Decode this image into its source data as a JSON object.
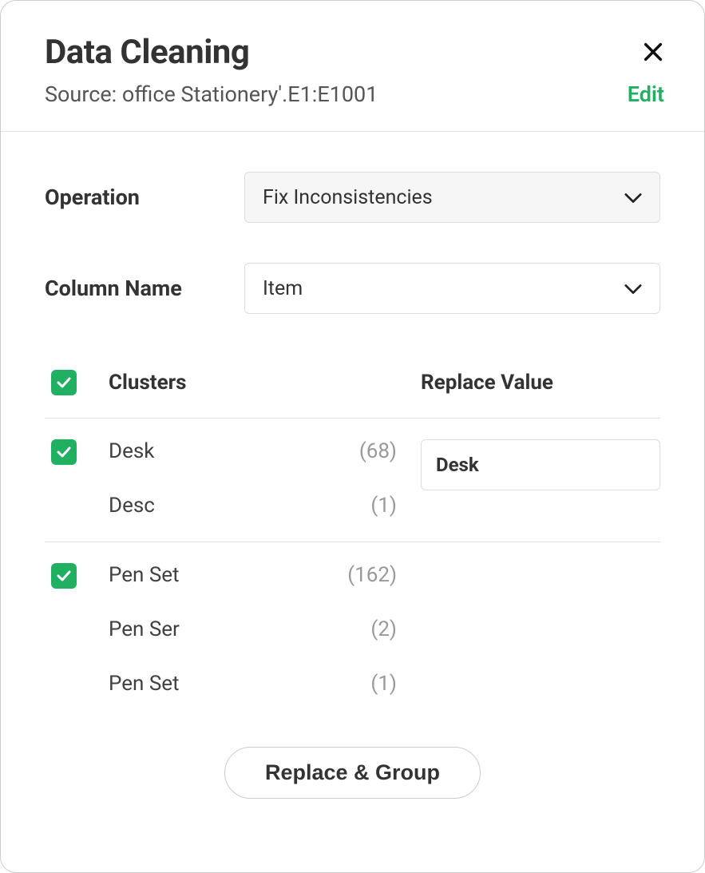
{
  "header": {
    "title": "Data Cleaning",
    "source": "Source: office Stationery'.E1:E1001",
    "edit": "Edit"
  },
  "form": {
    "operation_label": "Operation",
    "operation_value": "Fix Inconsistencies",
    "column_label": "Column Name",
    "column_value": "Item"
  },
  "table": {
    "header_clusters": "Clusters",
    "header_replace": "Replace Value",
    "rows": [
      {
        "items": [
          {
            "name": "Desk",
            "count": "(68)"
          },
          {
            "name": "Desc",
            "count": "(1)"
          }
        ],
        "replace_value": "Desk"
      },
      {
        "items": [
          {
            "name": "Pen Set",
            "count": "(162)"
          },
          {
            "name": "Pen Ser",
            "count": "(2)"
          },
          {
            "name": "Pen Set",
            "count": "(1)"
          }
        ],
        "replace_value": ""
      }
    ]
  },
  "footer": {
    "button": "Replace & Group"
  },
  "colors": {
    "accent": "#21b062"
  }
}
